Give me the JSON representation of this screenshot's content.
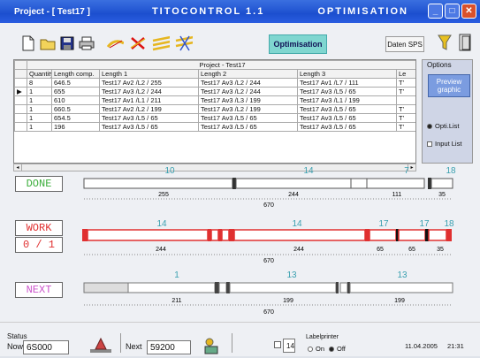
{
  "titlebar": {
    "project": "Project - [ Test17 ]",
    "app": "TITOCONTROL 1.1",
    "mode": "OPTIMISATION"
  },
  "toolbar": {
    "optimisation_label": "Optimisation",
    "sps_label": "Daten SPS"
  },
  "grid": {
    "caption": "Project - Test17",
    "headers": [
      "Quantity",
      "Length comp.",
      "Length 1",
      "Length 2",
      "Length 3",
      "Le"
    ],
    "rows": [
      [
        "8",
        "646.5",
        "Test17 Av2 /L2 / 255",
        "Test17 Av3 /L2 / 244",
        "Test17 Av1 /L7 / 111",
        "T’"
      ],
      [
        "1",
        "655",
        "Test17 Av3 /L2 / 244",
        "Test17 Av3 /L2 / 244",
        "Test17 Av3 /L5 / 65",
        "T’"
      ],
      [
        "1",
        "610",
        "Test17 Av1 /L1 / 211",
        "Test17 Av3 /L3 / 199",
        "Test17 Av3 /L1 / 199",
        ""
      ],
      [
        "1",
        "660.5",
        "Test17 Av2 /L2 / 199",
        "Test17 Av3 /L2 / 199",
        "Test17 Av3 /L5 / 65",
        "T’"
      ],
      [
        "1",
        "654.5",
        "Test17 Av3 /L5 / 65",
        "Test17 Av3 /L5 / 65",
        "Test17 Av3 /L5 / 65",
        "T’"
      ],
      [
        "1",
        "196",
        "Test17 Av3 /L5 / 65",
        "Test17 Av3 /L5 / 65",
        "Test17 Av3 /L5 / 65",
        "T’"
      ]
    ]
  },
  "options": {
    "title": "Options",
    "preview_label": "Preview graphic",
    "radio1": "Opti.List",
    "radio2": "Input List"
  },
  "done": {
    "label": "DONE",
    "top_labels": [
      "10",
      "14",
      "7",
      "18"
    ],
    "dims": [
      "255",
      "244",
      "111",
      "35"
    ],
    "total": "670"
  },
  "work": {
    "label": "WORK",
    "counter": "0 / 1",
    "top_labels": [
      "14",
      "14",
      "17",
      "17",
      "18"
    ],
    "dims": [
      "244",
      "244",
      "65",
      "65",
      "35"
    ],
    "total": "670"
  },
  "next": {
    "label": "NEXT",
    "top_labels": [
      "1",
      "13",
      "13"
    ],
    "dims": [
      "211",
      "199",
      "199"
    ],
    "total": "670"
  },
  "status": {
    "status_label": "Status",
    "now_label": "Now",
    "now_value": "6S000",
    "next_label": "Next",
    "next_value": "59200",
    "num_box": "14",
    "labelprinter_label": "Labelprinter",
    "on_label": "On",
    "off_label": "Off",
    "date": "11.04.2005",
    "time": "21:31"
  },
  "colors": {
    "done": "#3cae3c",
    "work": "#e03030",
    "next": "#cc55cc",
    "label_blue": "#3aa0b0"
  }
}
